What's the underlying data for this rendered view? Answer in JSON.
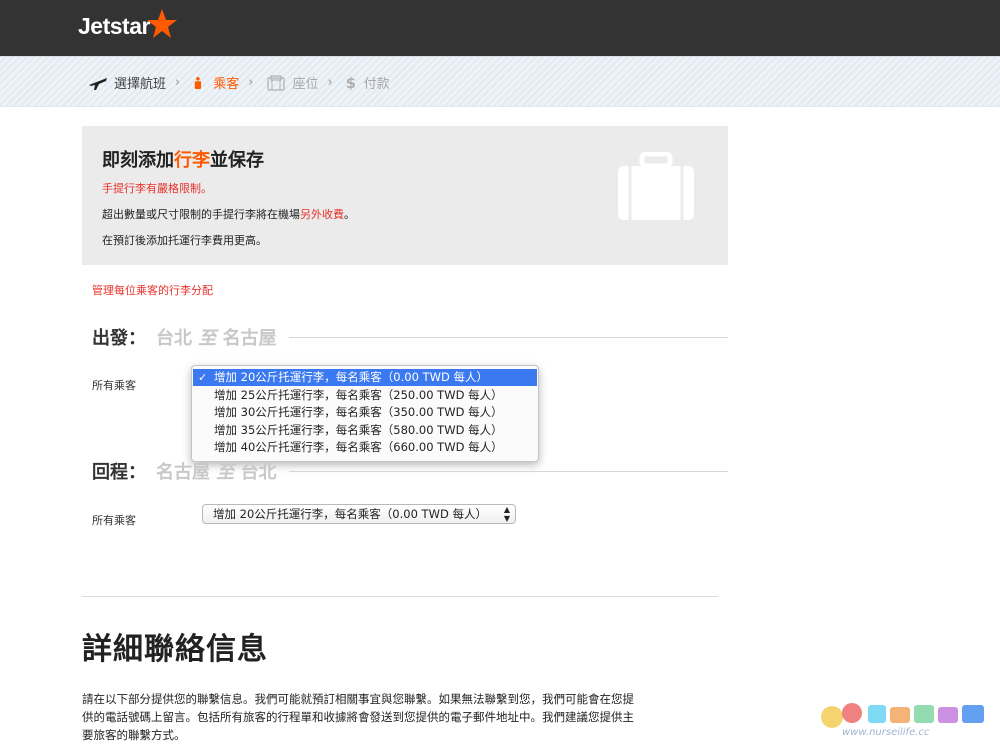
{
  "header": {
    "logo_text": "Jetstar"
  },
  "steps": [
    {
      "label": "選擇航班",
      "icon": "plane-icon",
      "state": "done"
    },
    {
      "label": "乘客",
      "icon": "person-icon",
      "state": "active"
    },
    {
      "label": "座位",
      "icon": "seat-icon",
      "state": "disabled"
    },
    {
      "label": "付款",
      "icon": "dollar-icon",
      "state": "disabled"
    }
  ],
  "promo": {
    "title_pre": "即刻添加",
    "title_highlight": "行李",
    "title_post": "並保存",
    "line1": "手提行李有嚴格限制。",
    "line2_pre": "超出數量或尺寸限制的手提行李將在機場",
    "line2_highlight": "另外收費",
    "line2_post": "。",
    "line3": "在預訂後添加托運行李費用更高。",
    "icon": "suitcase-icon"
  },
  "manage_link": "管理每位乘客的行李分配",
  "departure": {
    "label": "出發：",
    "from": "台北",
    "to_word": "至",
    "to": "名古屋",
    "passenger_label": "所有乘客",
    "options": [
      "增加 20公斤托運行李，每名乘客（0.00 TWD 每人）",
      "增加 25公斤托運行李，每名乘客（250.00 TWD 每人）",
      "增加 30公斤托運行李，每名乘客（350.00 TWD 每人）",
      "增加 35公斤托運行李，每名乘客（580.00 TWD 每人）",
      "增加 40公斤托運行李，每名乘客（660.00 TWD 每人）"
    ],
    "selected_index": 0
  },
  "return": {
    "label": "回程：",
    "from": "名古屋",
    "to_word": "至",
    "to": "台北",
    "passenger_label": "所有乘客",
    "selected_value": "增加 20公斤托運行李，每名乘客（0.00 TWD 每人）"
  },
  "contact": {
    "title": "詳細聯絡信息",
    "body_lines": [
      "請在以下部分提供您的聯繫信息。我們可能就預訂相關事宜與您聯繫。如果無法聯繫到您，我們可能會在您提",
      "供的電話號碼上留言。包括所有旅客的行程單和收據將會發送到您提供的電子郵件地址中。我們建議您提供主",
      "要旅客的聯繫方式。"
    ]
  },
  "watermark": {
    "text": "www.nurseilife.cc"
  },
  "colors": {
    "brand": "#ff5a00",
    "topbar": "#333333",
    "link_red": "#e8322b",
    "select_blue": "#3b79f0"
  }
}
